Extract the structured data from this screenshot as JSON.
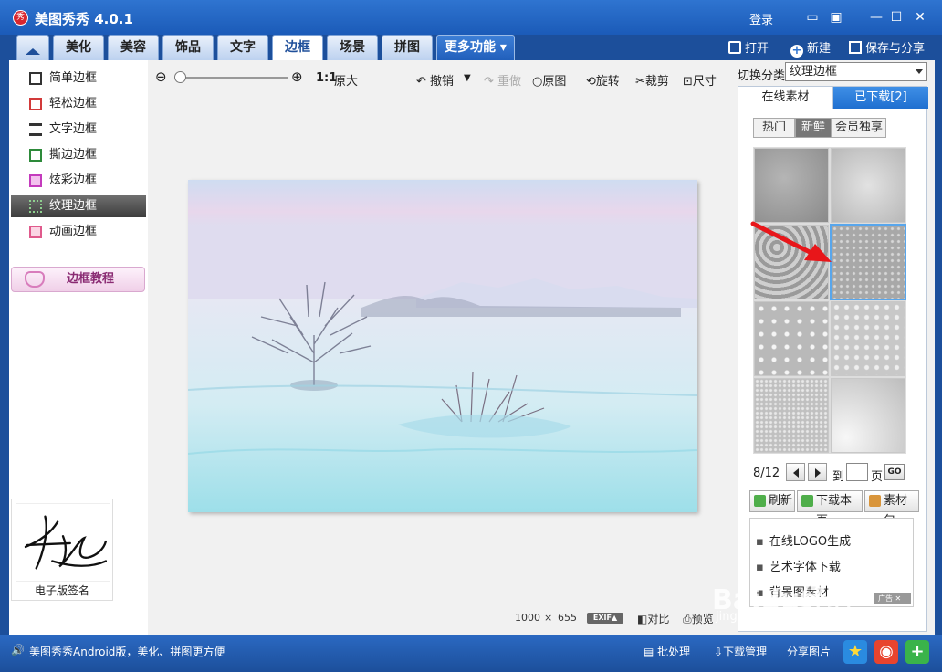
{
  "app": {
    "title": "美图秀秀 4.0.1",
    "logo_text": "秀",
    "login": "登录"
  },
  "tabs": [
    "美化",
    "美容",
    "饰品",
    "文字",
    "边框",
    "场景",
    "拼图",
    "更多功能 ▾"
  ],
  "top_actions": {
    "open": "打开",
    "new": "新建",
    "save_share": "保存与分享"
  },
  "sidebar": {
    "items": [
      "简单边框",
      "轻松边框",
      "文字边框",
      "撕边边框",
      "炫彩边框",
      "纹理边框",
      "动画边框"
    ],
    "active_index": 5,
    "tutorial": "边框教程",
    "signature_label": "电子版签名"
  },
  "toolbar": {
    "zoom_original": "原大",
    "zoom_ratio": "1:1",
    "undo": "撤销",
    "redo": "重做",
    "original": "原图",
    "rotate": "旋转",
    "crop": "裁剪",
    "size": "尺寸"
  },
  "image_info": {
    "width": "1000",
    "x": "×",
    "height": "655",
    "exif": "EXIF▲",
    "compare": "对比",
    "preview": "预览"
  },
  "right_panel": {
    "category_label": "切换分类",
    "category_value": "纹理边框",
    "tab_online": "在线素材",
    "tab_downloaded": "已下载[2]",
    "subtabs": [
      "热门",
      "新鲜",
      "会员独享"
    ],
    "pager_text": "8/12",
    "goto_label": "到",
    "page_label": "页",
    "go": "GO",
    "actions": {
      "refresh": "刷新",
      "download_page": "下载本页",
      "pack": "素材包"
    },
    "links": [
      "在线LOGO生成",
      "艺术字体下载",
      "背景图素材"
    ],
    "ad_tag": "广告 ✕"
  },
  "statusbar": {
    "promo": "美图秀秀Android版，美化、拼图更方便",
    "batch": "批处理",
    "download_manager": "下载管理",
    "share_image": "分享图片"
  },
  "watermark": {
    "main": "Baidu经验",
    "sub": "jingyan.baidu.com"
  },
  "colors": {
    "titlebar": "#2f74d0",
    "accent": "#1f6fd0",
    "selected_border": "#58a6ec",
    "arrow": "#e8161a"
  }
}
